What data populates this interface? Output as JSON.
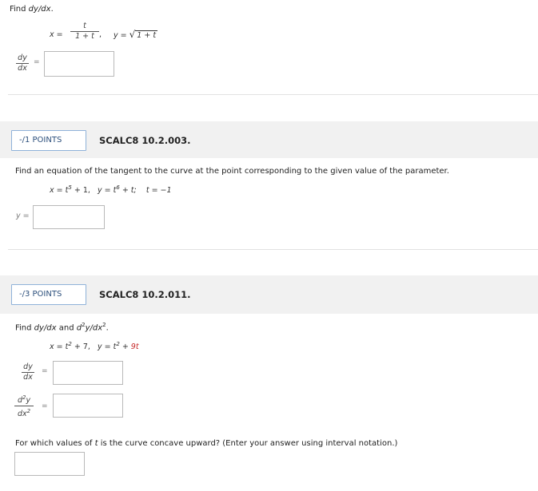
{
  "q1": {
    "prompt_a": "Find ",
    "prompt_b": "dy/dx",
    "prompt_c": ".",
    "x_label": "x =",
    "x_num": "t",
    "x_den": "1 + t",
    "x_comma": ",",
    "y_label": "y =",
    "y_sqrt_glyph": "√",
    "y_sqrt_body": "1 + t",
    "lhs_num": "dy",
    "lhs_den": "dx",
    "eq": "="
  },
  "q2": {
    "points": "-/1 POINTS",
    "id": "SCALC8 10.2.003.",
    "prompt": "Find an equation of the tangent to the curve at the point corresponding to the given value of the parameter.",
    "x_eq": "x = t",
    "x_exp": "5",
    "x_rest": " + 1,",
    "y_eq": "y = t",
    "y_exp": "6",
    "y_rest": " + t;",
    "t_eq": "t = −1",
    "answer_label": "y ="
  },
  "q3": {
    "points": "-/3 POINTS",
    "id": "SCALC8 10.2.011.",
    "prompt_a": "Find ",
    "prompt_b": "dy/dx",
    "prompt_c": " and ",
    "prompt_d": "d",
    "prompt_d_exp": "2",
    "prompt_e": "y/dx",
    "prompt_e_exp": "2",
    "prompt_f": ".",
    "x_eq": "x = t",
    "x_exp": "2",
    "x_rest": " + 7,",
    "y_eq": "y = t",
    "y_exp": "2",
    "y_plus": " + ",
    "y_red": "9t",
    "frac1_num": "dy",
    "frac1_den": "dx",
    "frac2_num_a": "d",
    "frac2_num_exp": "2",
    "frac2_num_b": "y",
    "frac2_den_a": "dx",
    "frac2_den_exp": "2",
    "eq": "=",
    "concave_a": "For which values of ",
    "concave_t": "t",
    "concave_b": " is the curve concave upward? (Enter your answer using interval notation.)"
  },
  "colors": {
    "accent": "#2c4f7c",
    "border_accent": "#8fb2d9",
    "highlight": "#c62828"
  }
}
